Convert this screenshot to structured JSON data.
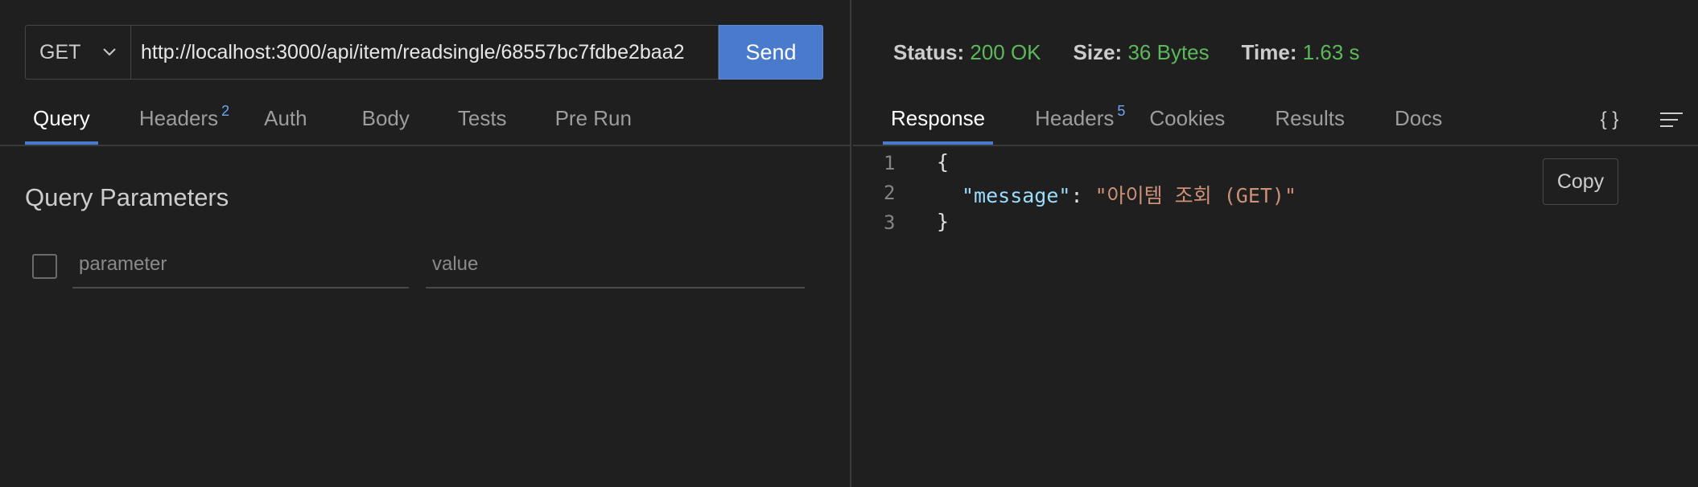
{
  "request": {
    "method": "GET",
    "url": "http://localhost:3000/api/item/readsingle/68557bc7fdbe2baa2",
    "send_label": "Send"
  },
  "request_tabs": [
    {
      "label": "Query",
      "badge": ""
    },
    {
      "label": "Headers",
      "badge": "2"
    },
    {
      "label": "Auth",
      "badge": ""
    },
    {
      "label": "Body",
      "badge": ""
    },
    {
      "label": "Tests",
      "badge": ""
    },
    {
      "label": "Pre Run",
      "badge": ""
    }
  ],
  "query": {
    "title": "Query Parameters",
    "param_placeholder": "parameter",
    "value_placeholder": "value"
  },
  "status": {
    "status_label": "Status:",
    "status_value": "200 OK",
    "size_label": "Size:",
    "size_value": "36 Bytes",
    "time_label": "Time:",
    "time_value": "1.63 s"
  },
  "response_tabs": [
    {
      "label": "Response",
      "badge": ""
    },
    {
      "label": "Headers",
      "badge": "5"
    },
    {
      "label": "Cookies",
      "badge": ""
    },
    {
      "label": "Results",
      "badge": ""
    },
    {
      "label": "Docs",
      "badge": ""
    }
  ],
  "response_icons": {
    "braces": "{ }",
    "menu_icon": "lines-icon"
  },
  "response_body": {
    "lines": [
      {
        "num": "1",
        "open": "{"
      },
      {
        "num": "2",
        "key": "\"message\"",
        "sep": ": ",
        "value": "\"아이템 조회 (GET)\""
      },
      {
        "num": "3",
        "close": "}"
      }
    ]
  },
  "copy_label": "Copy",
  "colors": {
    "accent": "#4a7acb",
    "status_ok": "#5cb85c",
    "badge": "#6ca7f0"
  }
}
